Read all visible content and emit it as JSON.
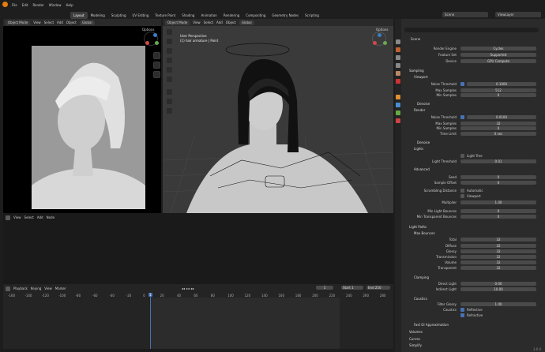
{
  "app": {
    "menus": [
      "File",
      "Edit",
      "Render",
      "Window",
      "Help"
    ],
    "workspaces": [
      "Layout",
      "Modeling",
      "Sculpting",
      "UV Editing",
      "Texture Paint",
      "Shading",
      "Animation",
      "Rendering",
      "Compositing",
      "Geometry Nodes",
      "Scripting"
    ],
    "active_workspace": "Layout",
    "scene": "Scene",
    "view_layer": "ViewLayer",
    "version": "3.6.0"
  },
  "left_view": {
    "mode": "Object Mode",
    "menus": [
      "View",
      "Select",
      "Add",
      "Object"
    ],
    "transform": "Global",
    "options": "Options"
  },
  "main_view": {
    "mode": "Object Mode",
    "menus": [
      "View",
      "Select",
      "Add",
      "Object"
    ],
    "transform": "Global",
    "options": "Options",
    "overlay_title": "User Perspective",
    "overlay_sub": "(1) hair armature | Point"
  },
  "node_editor": {
    "menus": [
      "View",
      "Select",
      "Add",
      "Node"
    ]
  },
  "timeline": {
    "menus": [
      "Playback",
      "Keying",
      "View",
      "Marker"
    ],
    "current_frame": "1",
    "start_label": "Start",
    "start": "1",
    "end_label": "End",
    "end": "250",
    "ticks": [
      "-160",
      "-140",
      "-120",
      "-100",
      "-80",
      "-60",
      "-40",
      "-20",
      "0",
      "20",
      "40",
      "60",
      "80",
      "100",
      "120",
      "140",
      "160",
      "180",
      "200",
      "220",
      "240",
      "260",
      "280"
    ]
  },
  "properties": {
    "tab": "Scene",
    "render_engine_label": "Render Engine",
    "render_engine": "Cycles",
    "feature_set_label": "Feature Set",
    "feature_set": "Supported",
    "device_label": "Device",
    "device": "GPU Compute",
    "sampling": "Sampling",
    "viewport": "Viewport",
    "noise_threshold_label": "Noise Threshold",
    "vp_noise": "0.1000",
    "max_samples_label": "Max Samples",
    "vp_max": "512",
    "min_samples_label": "Min Samples",
    "vp_min": "0",
    "denoise": "Denoise",
    "render": "Render",
    "r_noise": "0.0100",
    "r_max": "32",
    "r_min": "0",
    "time_limit_label": "Time Limit",
    "r_time": "0 sec",
    "lights": "Lights",
    "light_tree": "Light Tree",
    "light_threshold_label": "Light Threshold",
    "light_threshold": "0.01",
    "advanced": "Advanced",
    "seed_label": "Seed",
    "seed": "0",
    "sample_offset_label": "Sample Offset",
    "sample_offset": "0",
    "scrambling_label": "Scrambling Distance",
    "automatic": "Automatic",
    "viewport_chk": "Viewport",
    "multiplier_label": "Multiplier",
    "multiplier": "1.00",
    "min_light_bounces_label": "Min Light Bounces",
    "min_light_bounces": "0",
    "min_transparent_bounces_label": "Min Transparent Bounces",
    "min_transparent_bounces": "0",
    "light_paths": "Light Paths",
    "max_bounces": "Max Bounces",
    "total_label": "Total",
    "total": "32",
    "diffuse_label": "Diffuse",
    "diffuse": "32",
    "glossy_label": "Glossy",
    "glossy": "32",
    "transmission_label": "Transmission",
    "transmission": "32",
    "volume_label": "Volume",
    "volume": "32",
    "transparent_label": "Transparent",
    "transparent": "32",
    "clamping": "Clamping",
    "direct_light_label": "Direct Light",
    "direct_light": "0.00",
    "indirect_light_label": "Indirect Light",
    "indirect_light": "10.00",
    "caustics": "Caustics",
    "filter_glossy_label": "Filter Glossy",
    "filter_glossy": "1.00",
    "caustics_label": "Caustics",
    "reflective": "Reflective",
    "refractive": "Refractive",
    "fast_gi": "Fast GI Approximation",
    "volumes": "Volumes",
    "curves": "Curves",
    "simplify": "Simplify"
  },
  "colors": {
    "accent": "#4772b3",
    "timeline_marker": "#4772b3",
    "bg": "#1d1d1d"
  }
}
